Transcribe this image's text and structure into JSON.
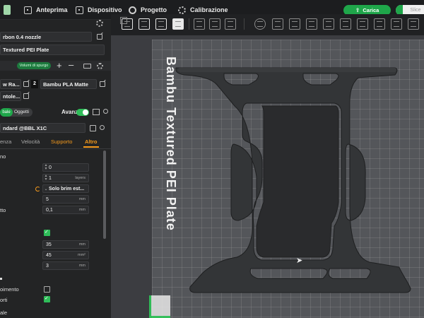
{
  "menu": {
    "preview": "Anteprima",
    "device": "Dispositivo",
    "project": "Progetto",
    "calibration": "Calibrazione",
    "load_button": "Carica",
    "slice_button": "Slice"
  },
  "left_panel": {
    "nozzle": "rbon 0.4 nozzle",
    "plate": "Textured PEI Plate",
    "purge_pill": "Volumi di spurgo",
    "filament_left_a": "w Ra...",
    "filament_left_b": "ntole...",
    "filament_slot": "2",
    "filament_right": "Bambu PLA Matte",
    "toggle_left": "bale",
    "toggle_right": "Oggetti",
    "advanced": "Avanzato",
    "process": "ndard @BBL X1C",
    "tabs": [
      "enza",
      "Velocità",
      "Supporto",
      "Altro"
    ],
    "section_label_1": "no",
    "values": {
      "v1": "0",
      "v2": "1",
      "v2_unit": "layers",
      "brim": "Solo brim est...",
      "v3": "5",
      "v3_unit": "mm",
      "v4": "0,1",
      "v4_unit": "mm",
      "v4_label": "tto",
      "v5": "35",
      "v5_unit": "mm",
      "v6": "45",
      "v6_unit": "mm²",
      "v7": "3",
      "v7_unit": "mm",
      "label_fill": "oimento",
      "label_supports": "orti",
      "label_bottom": "ale"
    }
  },
  "viewport": {
    "plate_label": "Bambu Textured PEI Plate"
  },
  "colors": {
    "accent": "#1fa64a",
    "tab_active": "#f59a1c",
    "plate": "#54565a",
    "part": "#333537"
  }
}
